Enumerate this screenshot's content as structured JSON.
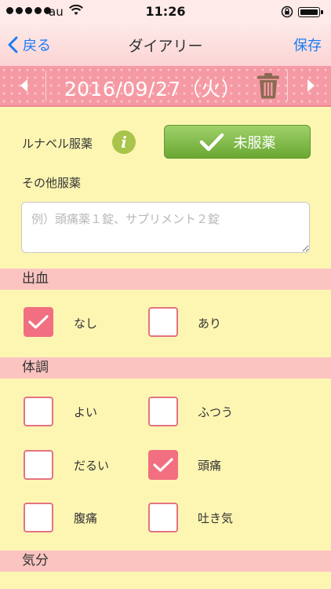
{
  "status_bar": {
    "carrier": "au",
    "time": "11:26"
  },
  "nav": {
    "back_label": "戻る",
    "title": "ダイアリー",
    "save_label": "保存"
  },
  "date_bar": {
    "date": "2016/09/27（火）"
  },
  "medication": {
    "label": "ルナベル服薬",
    "button_label": "未服薬",
    "other_label": "その他服薬",
    "other_placeholder": "例）頭痛薬１錠、サプリメント２錠",
    "other_value": ""
  },
  "bleeding": {
    "header": "出血",
    "options": [
      {
        "label": "なし",
        "checked": true
      },
      {
        "label": "あり",
        "checked": false
      }
    ]
  },
  "condition": {
    "header": "体調",
    "options": [
      {
        "label": "よい",
        "checked": false
      },
      {
        "label": "ふつう",
        "checked": false
      },
      {
        "label": "だるい",
        "checked": false
      },
      {
        "label": "頭痛",
        "checked": true
      },
      {
        "label": "腹痛",
        "checked": false
      },
      {
        "label": "吐き気",
        "checked": false
      }
    ]
  },
  "mood": {
    "header": "気分"
  },
  "colors": {
    "accent_pink": "#f16f80",
    "header_pink": "#fbc4c1",
    "background_yellow": "#fdf6b3",
    "button_green": "#7bb844",
    "link_blue": "#1a7cf5"
  }
}
